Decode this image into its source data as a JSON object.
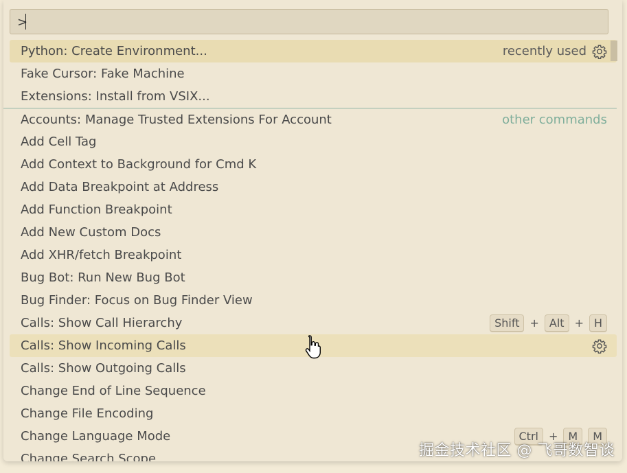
{
  "search": {
    "value": ">"
  },
  "recent": [
    {
      "label": "Python: Create Environment...",
      "hint": "recently used",
      "icon": "gear-icon",
      "selected": true
    },
    {
      "label": "Fake Cursor: Fake Machine"
    },
    {
      "label": "Extensions: Install from VSIX..."
    }
  ],
  "commands": [
    {
      "label": "Accounts: Manage Trusted Extensions For Account",
      "hint": "other commands"
    },
    {
      "label": "Add Cell Tag"
    },
    {
      "label": "Add Context to Background for Cmd K"
    },
    {
      "label": "Add Data Breakpoint at Address"
    },
    {
      "label": "Add Function Breakpoint"
    },
    {
      "label": "Add New Custom Docs"
    },
    {
      "label": "Add XHR/fetch Breakpoint"
    },
    {
      "label": "Bug Bot: Run New Bug Bot"
    },
    {
      "label": "Bug Finder: Focus on Bug Finder View"
    },
    {
      "label": "Calls: Show Call Hierarchy",
      "keys": [
        "Shift",
        "+",
        "Alt",
        "+",
        "H"
      ]
    },
    {
      "label": "Calls: Show Incoming Calls",
      "icon": "gear-icon",
      "hovered": true
    },
    {
      "label": "Calls: Show Outgoing Calls"
    },
    {
      "label": "Change End of Line Sequence"
    },
    {
      "label": "Change File Encoding"
    },
    {
      "label": "Change Language Mode",
      "keys": [
        "Ctrl",
        "+",
        "M",
        "M"
      ]
    },
    {
      "label": "Change Search Scope"
    }
  ],
  "watermark": "掘金技术社区 @ 飞哥数智谈",
  "colors": {
    "background": "#efe7d4",
    "selected": "#e9dcb2",
    "separator": "#8fb5a6",
    "hint_green": "#7fae9b"
  }
}
